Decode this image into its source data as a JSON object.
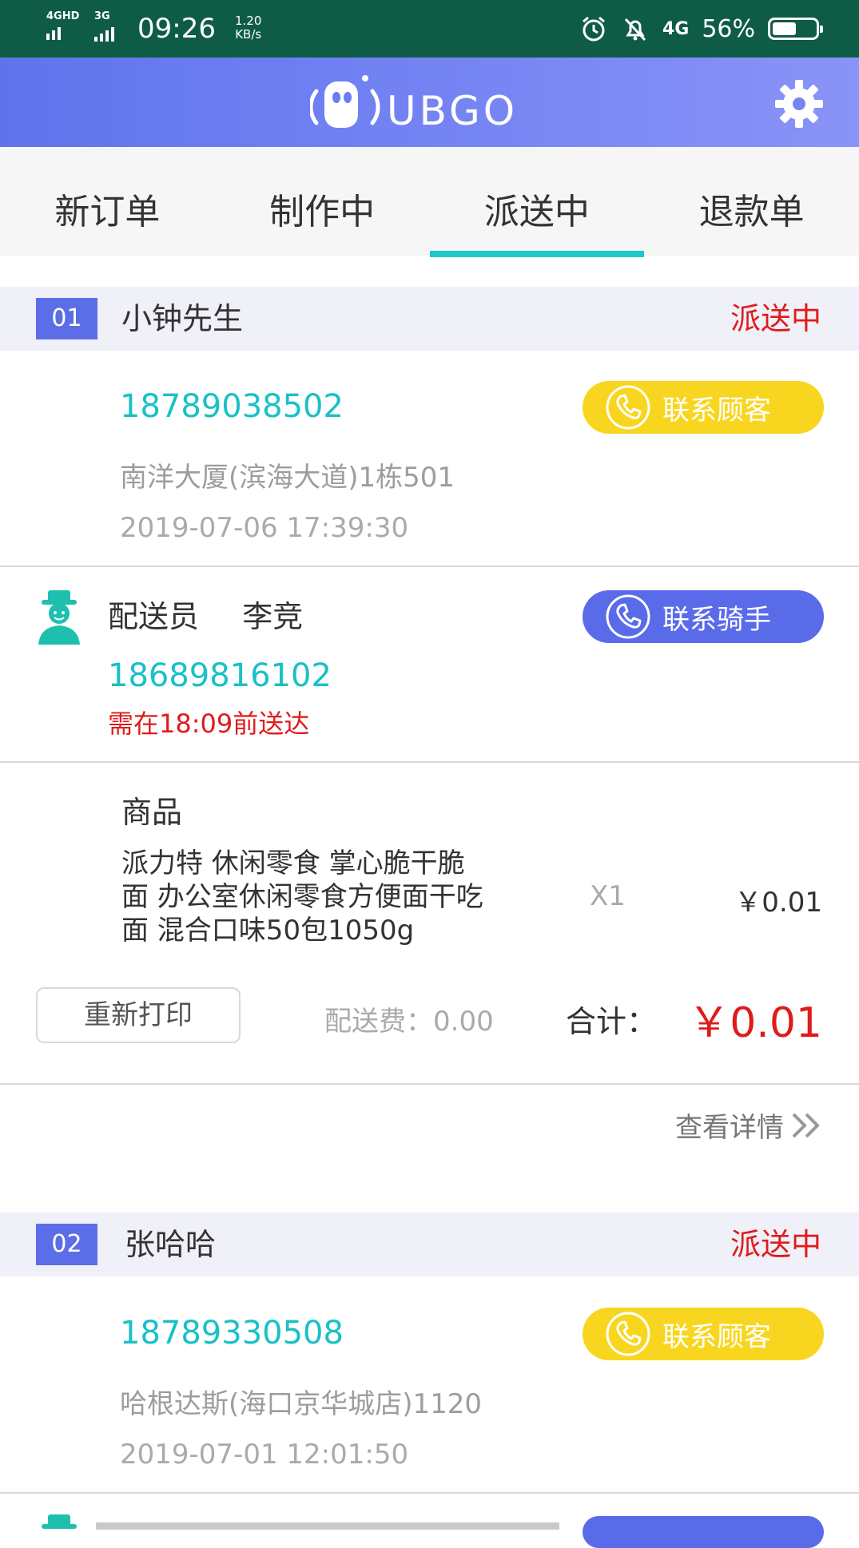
{
  "status_bar": {
    "network1": "4GHD",
    "network2": "3G",
    "time": "09:26",
    "speed_value": "1.20",
    "speed_unit": "KB/s",
    "network3": "4G",
    "battery": "56%",
    "battery_level": 0.56,
    "icons": [
      "alarm-icon",
      "bell-muted-icon",
      "signal-4g-icon",
      "battery-icon"
    ]
  },
  "header": {
    "logo_text": "UBGO",
    "settings_icon": "gear-icon"
  },
  "tabs": [
    {
      "label": "新订单"
    },
    {
      "label": "制作中"
    },
    {
      "label": "派送中"
    },
    {
      "label": "退款单"
    }
  ],
  "active_tab": "派送中",
  "colors": {
    "accent": "#5b6ee8",
    "cyan": "#19c1c6",
    "red": "#e01b1b",
    "yellow": "#f8d61f",
    "status_bar": "#0f5c46"
  },
  "orders": [
    {
      "number": "01",
      "customer": "小钟先生",
      "status": "派送中",
      "phone": "18789038502",
      "address": "南洋大厦(滨海大道)1栋501",
      "time": "2019-07-06 17:39:30",
      "contact_customer": "联系顾客",
      "courier_label": "配送员",
      "courier_name": "李竞",
      "courier_phone": "18689816102",
      "contact_rider": "联系骑手",
      "deadline": "需在18:09前送达",
      "goods_label": "商品",
      "items": [
        {
          "name_lines": [
            "派力特 休闲零食 掌心脆干脆",
            "面 办公室休闲零食方便面干吃",
            "面 混合口味50包1050g"
          ],
          "qty": "X1",
          "price": "￥0.01"
        }
      ],
      "reprint": "重新打印",
      "delivery_fee": "配送费：0.00",
      "total_label": "合计：",
      "total": "￥0.01",
      "view_details": "查看详情"
    },
    {
      "number": "02",
      "customer": "张哈哈",
      "status": "派送中",
      "phone": "18789330508",
      "address": "哈根达斯(海口京华城店)1120",
      "time": "2019-07-01 12:01:50",
      "contact_customer": "联系顾客"
    }
  ]
}
